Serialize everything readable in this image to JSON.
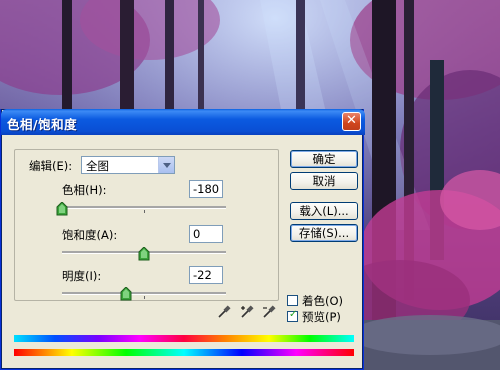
{
  "dialog": {
    "title": "色相/饱和度",
    "close_icon": "close-icon"
  },
  "edit": {
    "label": "编辑(E):",
    "value": "全图"
  },
  "hue": {
    "label": "色相(H):",
    "value": "-180",
    "level": -180,
    "min": -180,
    "max": 180
  },
  "saturation": {
    "label": "饱和度(A):",
    "value": "0",
    "level": 0,
    "min": -100,
    "max": 100
  },
  "lightness": {
    "label": "明度(I):",
    "value": "-22",
    "level": -22,
    "min": -100,
    "max": 100
  },
  "buttons": {
    "ok": "确定",
    "cancel": "取消",
    "load": "载入(L)...",
    "save": "存储(S)..."
  },
  "colorize": {
    "label": "着色(O)",
    "checked": false
  },
  "preview": {
    "label": "预览(P)",
    "checked": true
  },
  "icons": [
    "eyedropper-icon",
    "eyedropper-plus-icon",
    "eyedropper-minus-icon"
  ]
}
